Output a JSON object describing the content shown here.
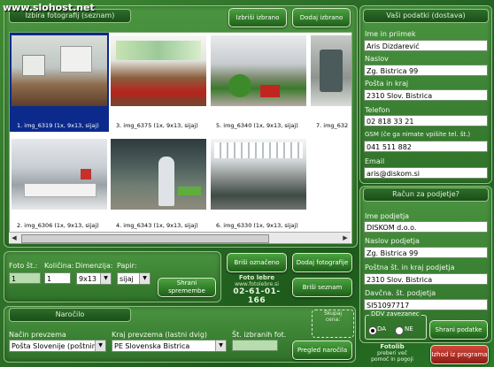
{
  "watermark": "www.slohost.net",
  "gallery_header": "Izbira fotografij (seznam)",
  "btn_delete_photos": "Izbriši izbrano",
  "btn_add_photos": "Dodaj izbrano",
  "thumbs": [
    {
      "caption": "1. img_6319 (1x, 9x13, sijaj)",
      "selected": true
    },
    {
      "caption": "3. img_6375 (1x, 9x13, sijaj)",
      "selected": false
    },
    {
      "caption": "5. img_6340 (1x, 9x13, sijaj)",
      "selected": false
    },
    {
      "caption": "7. img_632",
      "selected": false
    },
    {
      "caption": "2. img_6306 (1x, 9x13, sijaj)",
      "selected": false
    },
    {
      "caption": "4. img_6343 (1x, 9x13, sijaj)",
      "selected": false
    },
    {
      "caption": "6. img_6330 (1x, 9x13, sijaj)",
      "selected": false
    }
  ],
  "photo_no_label": "Foto št.:",
  "photo_no_value": "1",
  "qty_label": "Količina:",
  "qty_value": "1",
  "dim_label": "Dimenzija:",
  "dim_value": "9x13",
  "paper_label": "Papir:",
  "paper_value": "sijaj",
  "btn_save_changes": "Shrani spremembe",
  "btn_remove_selected": "Briši označeno",
  "btn_add_photos2": "Dodaj fotografije",
  "btn_clear_list": "Briši seznam",
  "promo_line1": "Foto lebre",
  "promo_line2": "www.fotolebre.si",
  "promo_phone": "02-61-01-166",
  "order_header": "Naročilo",
  "delivery_label": "Način prevzema",
  "delivery_value": "Pošta Slovenije (poštnina)",
  "place_label": "Kraj prevzema (lastni dvig)",
  "place_value": "PE Slovenska Bistrica",
  "count_label": "Št. izbranih fot.",
  "count_value": "",
  "price_label1": "Skupaj",
  "price_label2": "cena:",
  "price_value": "",
  "btn_review_order": "Pregled naročila",
  "customer_header": "Vaši podatki (dostava)",
  "name_label": "Ime in priimek",
  "name_value": "Aris Dizdarević",
  "addr_label": "Naslov",
  "addr_value": "Zg. Bistrica 99",
  "post_label": "Pošta in kraj",
  "post_value": "2310 Slov. Bistrica",
  "phone_label": "Telefon",
  "phone_value": "02 818 33 21",
  "gsm_label": "GSM (če ga nimate vpišite tel. št.)",
  "gsm_value": "041 511 882",
  "email_label": "Email",
  "email_value": "aris@diskom.si",
  "company_header": "Račun za podjetje?",
  "cname_label": "Ime podjetja",
  "cname_value": "DISKOM d.o.o.",
  "caddr_label": "Naslov podjetja",
  "caddr_value": "Zg. Bistrica 99",
  "cpost_label": "Poštna št. in kraj podjetja",
  "cpost_value": "2310 Slov. Bistrica",
  "tax_label": "Davčna. št. podjetja",
  "tax_value": "SI51097717",
  "vat_label": "DDV zavezanec",
  "vat_yes": "DA",
  "vat_no": "NE",
  "btn_save_data": "Shrani podatke",
  "info_line1": "Fotolib",
  "info_line2": "preberi več",
  "info_line3": "pomoč in pogoji",
  "btn_exit": "Izhod iz programa",
  "colors": {
    "accent": "#2f7a2a",
    "selected": "#0b2a8c",
    "exit": "#b8332a"
  }
}
